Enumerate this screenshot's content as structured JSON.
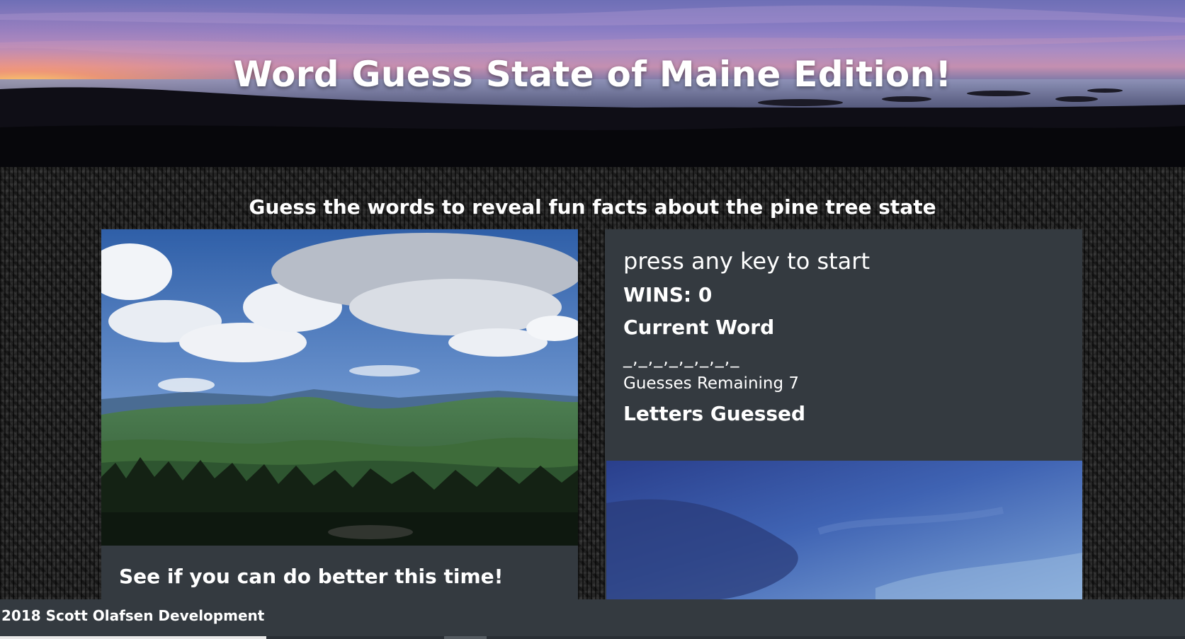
{
  "header": {
    "title": "Word Guess State of Maine Edition!"
  },
  "main": {
    "tagline": "Guess the words to reveal fun facts about the pine tree state"
  },
  "left_card": {
    "caption": "See if you can do better this time!"
  },
  "game": {
    "status": "press any key to start",
    "wins": "WINS: 0",
    "current_word_label": "Current Word",
    "current_word": "_,_,_,_,_,_,_,_",
    "guesses_remaining": "Guesses Remaining 7",
    "letters_guessed_label": "Letters Guessed"
  },
  "footer": {
    "credit": "2018 Scott Olafsen Development"
  },
  "colors": {
    "card_bg": "#343a40",
    "footer_bg": "#343a40",
    "pattern_bg": "#252525"
  }
}
